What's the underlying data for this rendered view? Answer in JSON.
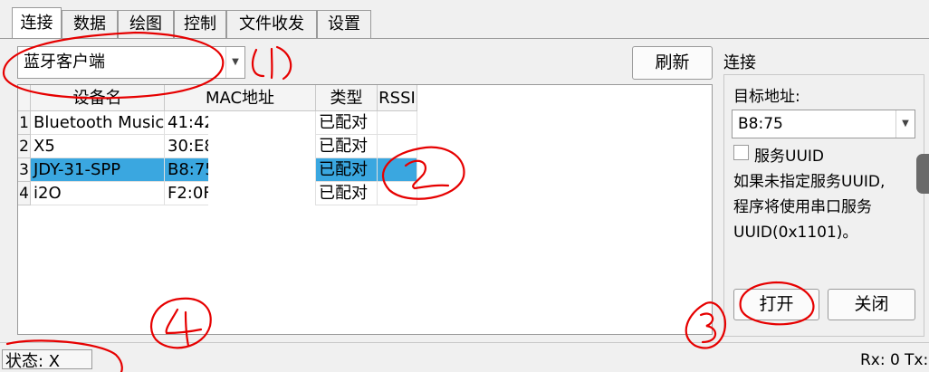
{
  "tabs": [
    {
      "label": "连接",
      "active": true
    },
    {
      "label": "数据",
      "active": false
    },
    {
      "label": "绘图",
      "active": false
    },
    {
      "label": "控制",
      "active": false
    },
    {
      "label": "文件收发",
      "active": false
    },
    {
      "label": "设置",
      "active": false
    }
  ],
  "mode_select": {
    "value": "蓝牙客户端"
  },
  "refresh_label": "刷新",
  "device_table": {
    "columns": [
      "设备名",
      "MAC地址",
      "类型",
      "RSSI"
    ],
    "rows": [
      {
        "index": "1",
        "name": "Bluetooth Music",
        "mac": "41:42",
        "type": "已配对",
        "rssi": ""
      },
      {
        "index": "2",
        "name": "X5",
        "mac": "30:E8",
        "type": "已配对",
        "rssi": ""
      },
      {
        "index": "3",
        "name": "JDY-31-SPP",
        "mac": "B8:75",
        "type": "已配对",
        "rssi": "",
        "selected": true
      },
      {
        "index": "4",
        "name": "i2O",
        "mac": "F2:0F",
        "type": "已配对",
        "rssi": ""
      }
    ]
  },
  "connect_panel": {
    "title": "连接",
    "target_label": "目标地址:",
    "target_value": "B8:75",
    "service_uuid_label": "服务UUID",
    "service_uuid_checked": false,
    "hint": [
      "如果未指定服务UUID,",
      "程序将使用串口服务",
      "UUID(0x1101)。"
    ],
    "open_label": "打开",
    "close_label": "关闭"
  },
  "status": {
    "state_text": "状态: X",
    "rx_text": "Rx: 0",
    "tx_text": "Tx:"
  },
  "annotations": [
    "1",
    "2",
    "3",
    "4"
  ],
  "colors": {
    "selection": "#3aa7e0",
    "annotation": "#e60000"
  }
}
